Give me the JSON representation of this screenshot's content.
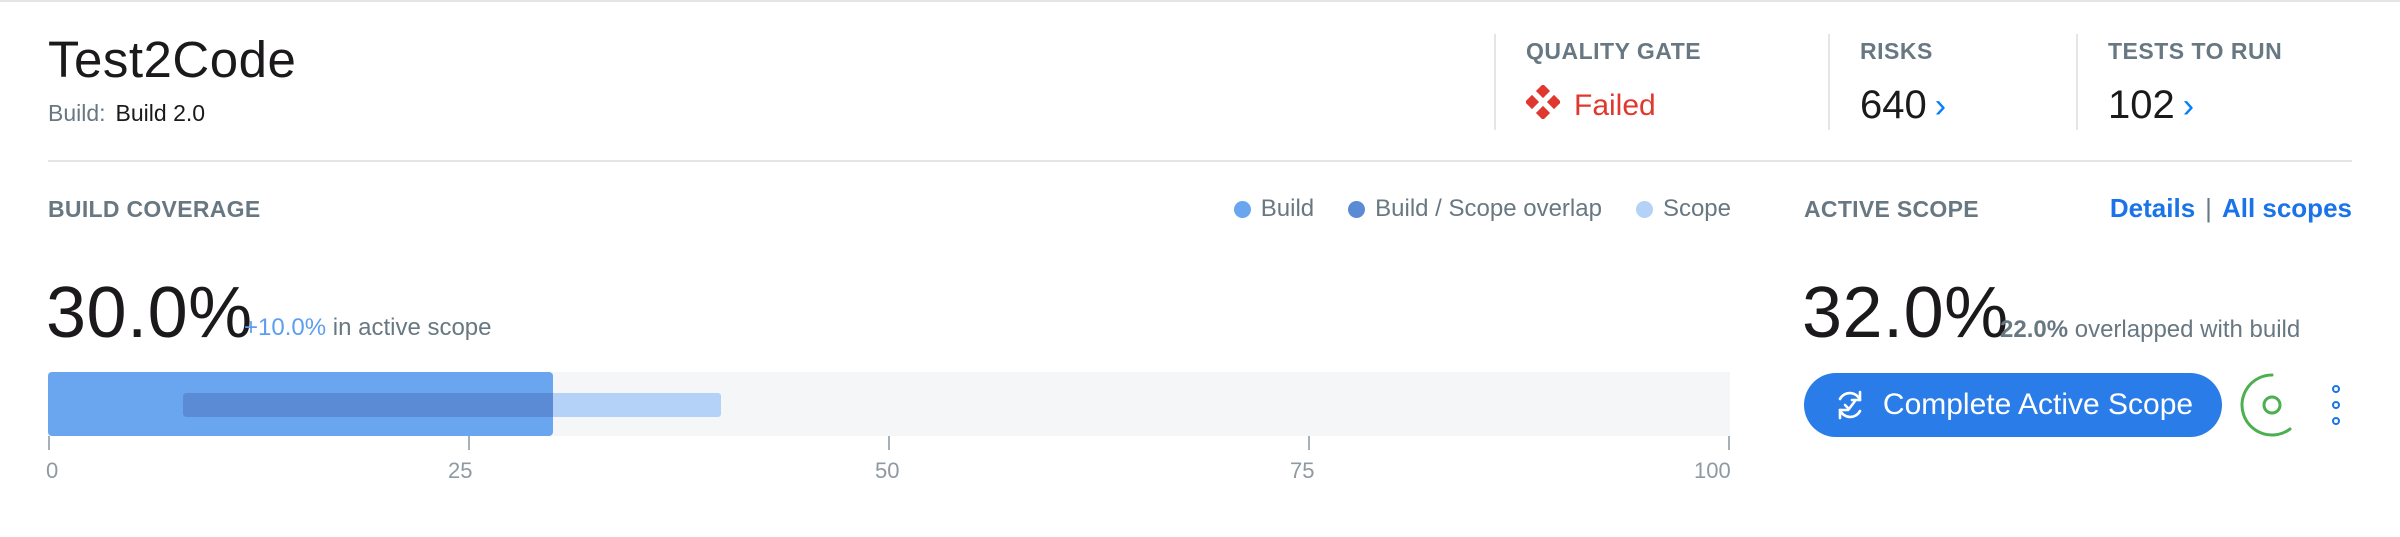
{
  "header": {
    "title": "Test2Code",
    "build_label": "Build:",
    "build_value": "Build 2.0"
  },
  "metrics": {
    "quality_gate": {
      "label": "QUALITY GATE",
      "status": "Failed",
      "status_color": "#e0382e"
    },
    "risks": {
      "label": "RISKS",
      "value": "640"
    },
    "tests_to_run": {
      "label": "TESTS TO RUN",
      "value": "102"
    }
  },
  "build_coverage": {
    "title": "BUILD COVERAGE",
    "legend": [
      {
        "label": "Build",
        "color": "#6aa5f0"
      },
      {
        "label": "Build / Scope overlap",
        "color": "#5a8bd4"
      },
      {
        "label": "Scope",
        "color": "#b4d1f7"
      }
    ],
    "percent": "30.0%",
    "delta": "+10.0%",
    "delta_suffix": "in active scope",
    "bar": {
      "build": 30.0,
      "overlap_start": 8,
      "scope_end": 40
    },
    "ticks": [
      "0",
      "25",
      "50",
      "75",
      "100"
    ]
  },
  "active_scope": {
    "title": "ACTIVE SCOPE",
    "details_link": "Details",
    "separator": "|",
    "all_scopes_link": "All scopes",
    "percent": "32.0%",
    "overlap_value": "22.0%",
    "overlap_suffix": "overlapped with build",
    "complete_button": "Complete Active Scope",
    "accent_color": "#2a7de8",
    "spinner_color": "#4caf50"
  }
}
